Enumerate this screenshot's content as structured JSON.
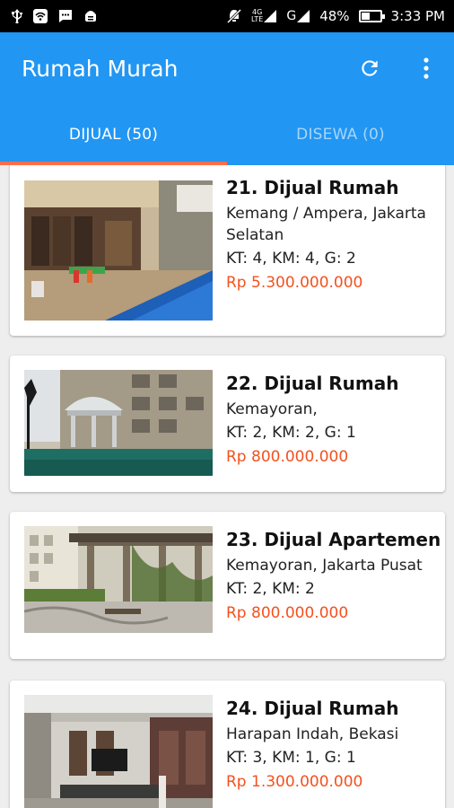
{
  "status_bar": {
    "network_label": "4G\nLTE",
    "sim2_label": "G",
    "battery": "48%",
    "time": "3:33 PM"
  },
  "app_bar": {
    "title": "Rumah Murah",
    "refresh_icon": "refresh-icon",
    "more_icon": "more-vert-icon"
  },
  "tabs": [
    {
      "label": "DIJUAL (50)",
      "active": true
    },
    {
      "label": "DISEWA (0)",
      "active": false
    }
  ],
  "listings": [
    {
      "title": "21. Dijual Rumah",
      "location": "Kemang / Ampera, Jakarta Selatan",
      "specs": "KT: 4, KM: 4, G: 2",
      "price": "Rp 5.300.000.000"
    },
    {
      "title": "22. Dijual Rumah",
      "location": "Kemayoran,",
      "specs": "KT: 2, KM: 2, G: 1",
      "price": "Rp 800.000.000"
    },
    {
      "title": "23. Dijual Apartemen",
      "location": "Kemayoran, Jakarta Pusat",
      "specs": "KT: 2, KM: 2",
      "price": "Rp 800.000.000"
    },
    {
      "title": "24. Dijual Rumah",
      "location": "Harapan Indah, Bekasi",
      "specs": "KT: 3, KM: 1, G: 1",
      "price": "Rp 1.300.000.000"
    }
  ],
  "colors": {
    "primary": "#2196f3",
    "accent": "#ff6e4a",
    "price": "#f4511e"
  }
}
